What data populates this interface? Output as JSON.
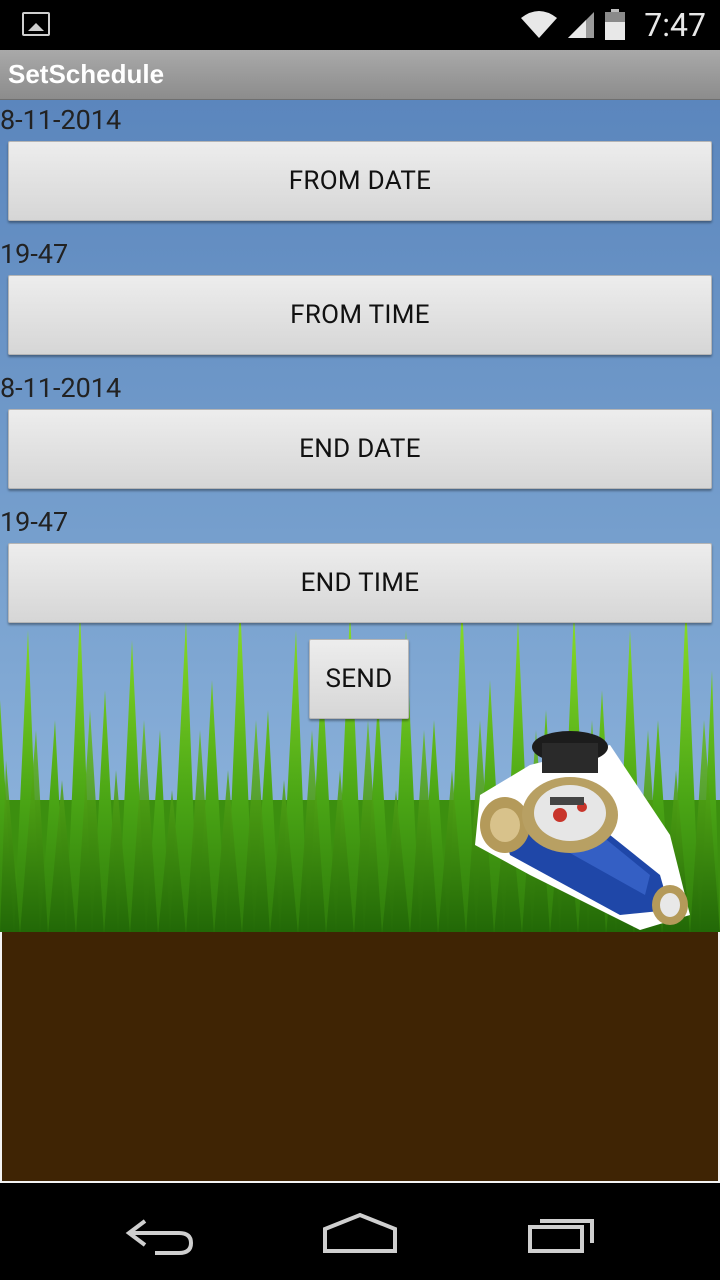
{
  "status_bar": {
    "time": "7:47",
    "icons": [
      "image-notification-icon",
      "wifi-icon",
      "cell-signal-icon",
      "battery-icon"
    ]
  },
  "action_bar": {
    "title": "SetSchedule"
  },
  "schedule": {
    "from_date_value": "8-11-2014",
    "from_date_button": "FROM DATE",
    "from_time_value": "19-47",
    "from_time_button": "FROM TIME",
    "end_date_value": "8-11-2014",
    "end_date_button": "END DATE",
    "end_time_value": "19-47",
    "end_time_button": "END TIME",
    "send_button": "SEND"
  },
  "navigation": {
    "buttons": [
      "back-icon",
      "home-icon",
      "recent-apps-icon"
    ]
  },
  "colors": {
    "sky_top": "#5b86bd",
    "grass": "#4da41a",
    "soil": "#3f2404",
    "button": "#e0e0e0"
  }
}
